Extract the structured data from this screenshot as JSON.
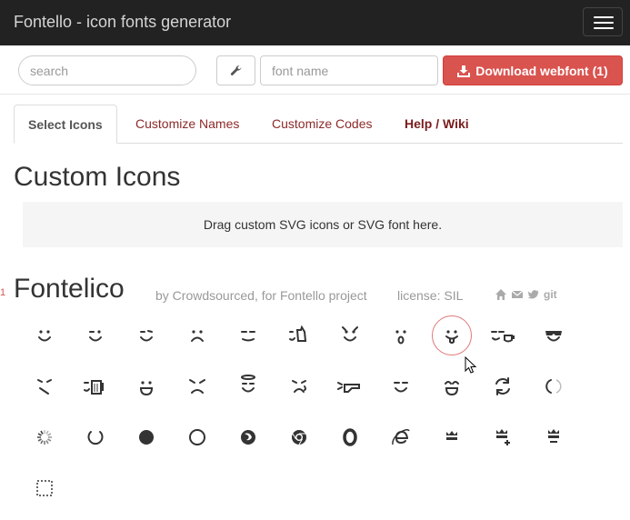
{
  "app": {
    "title": "Fontello - icon fonts generator",
    "menu_icon": "hamburger-menu-icon"
  },
  "toolbar": {
    "search_placeholder": "search",
    "settings_icon": "wrench-icon",
    "font_name_placeholder": "font name",
    "download_label": "Download webfont (1)",
    "download_icon": "download-icon",
    "download_color": "#d9534f"
  },
  "tabs": [
    {
      "label": "Select Icons",
      "active": true
    },
    {
      "label": "Customize Names",
      "active": false
    },
    {
      "label": "Customize Codes",
      "active": false
    },
    {
      "label": "Help / Wiki",
      "active": false
    }
  ],
  "custom_icons": {
    "heading": "Custom Icons",
    "dropzone_text": "Drag custom SVG icons or SVG font here."
  },
  "font_set": {
    "gutter_number": "1",
    "name": "Fontelico",
    "author": "by Crowdsourced, for Fontello project",
    "license": "license: SIL",
    "links": [
      "home-icon",
      "mail-icon",
      "twitter-icon",
      "git"
    ],
    "selected_count": 1,
    "icons": [
      "emo-happy-icon",
      "emo-wink-icon",
      "emo-wink2-icon",
      "emo-unhappy-icon",
      "emo-sleep-icon",
      "emo-thumbsup-icon",
      "emo-devil-icon",
      "emo-surprised-icon",
      "emo-tongue-icon",
      "emo-coffee-icon",
      "emo-sunglasses-icon",
      "emo-displeased-icon",
      "emo-beer-icon",
      "emo-grin-icon",
      "emo-angry-icon",
      "emo-saint-icon",
      "emo-cry-icon",
      "emo-shoot-icon",
      "emo-squint-icon",
      "emo-laugh-icon",
      "spin1-icon",
      "spin2-icon",
      "spin3-icon",
      "spin4-icon",
      "spin5-icon",
      "spin6-icon",
      "firefox-icon",
      "chrome-icon",
      "opera-icon",
      "ie-icon",
      "crown-icon",
      "crown-plus-icon",
      "crown-minus-icon",
      "marquee-icon"
    ],
    "selected_icon": "emo-tongue-icon"
  }
}
